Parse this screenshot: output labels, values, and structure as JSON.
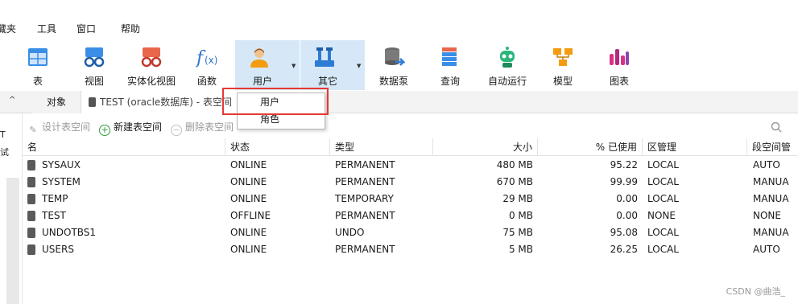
{
  "menu": {
    "items": [
      "藏夹",
      "工具",
      "窗口",
      "帮助"
    ]
  },
  "toolbar": {
    "buttons": [
      {
        "label": "表",
        "icon": "table-icon"
      },
      {
        "label": "视图",
        "icon": "view-icon"
      },
      {
        "label": "实体化视图",
        "icon": "materialized-view-icon"
      },
      {
        "label": "函数",
        "icon": "function-icon"
      },
      {
        "label": "用户",
        "icon": "user-icon"
      },
      {
        "label": "其它",
        "icon": "tools-icon"
      },
      {
        "label": "数据泵",
        "icon": "data-pump-icon"
      },
      {
        "label": "查询",
        "icon": "query-icon"
      },
      {
        "label": "自动运行",
        "icon": "robot-icon"
      },
      {
        "label": "模型",
        "icon": "model-icon"
      },
      {
        "label": "图表",
        "icon": "chart-icon"
      }
    ]
  },
  "tabs": {
    "object": "对象",
    "active": "TEST (oracle数据库) - 表空间"
  },
  "left": {
    "s1": "T",
    "s2": "试"
  },
  "actions": {
    "design": "设计表空间",
    "create": "新建表空间",
    "delete": "删除表空间"
  },
  "table": {
    "headers": [
      "名",
      "状态",
      "类型",
      "大小",
      "% 已使用",
      "区管理",
      "段空间管"
    ],
    "rows": [
      [
        "SYSAUX",
        "ONLINE",
        "PERMANENT",
        "480 MB",
        "95.22",
        "LOCAL",
        "AUTO"
      ],
      [
        "SYSTEM",
        "ONLINE",
        "PERMANENT",
        "670 MB",
        "99.99",
        "LOCAL",
        "MANUA"
      ],
      [
        "TEMP",
        "ONLINE",
        "TEMPORARY",
        "29 MB",
        "0.00",
        "LOCAL",
        "MANUA"
      ],
      [
        "TEST",
        "OFFLINE",
        "PERMANENT",
        "0 MB",
        "0.00",
        "NONE",
        "NONE"
      ],
      [
        "UNDOTBS1",
        "ONLINE",
        "UNDO",
        "75 MB",
        "95.08",
        "LOCAL",
        "MANUA"
      ],
      [
        "USERS",
        "ONLINE",
        "PERMANENT",
        "5 MB",
        "26.25",
        "LOCAL",
        "AUTO"
      ]
    ]
  },
  "dropdown": {
    "items": [
      "用户",
      "角色"
    ]
  },
  "watermark": "CSDN @曲浩_",
  "colors": {
    "highlight": "#e53935",
    "active_button": "#d6e8f7",
    "add_icon": "#2e9e3e"
  }
}
